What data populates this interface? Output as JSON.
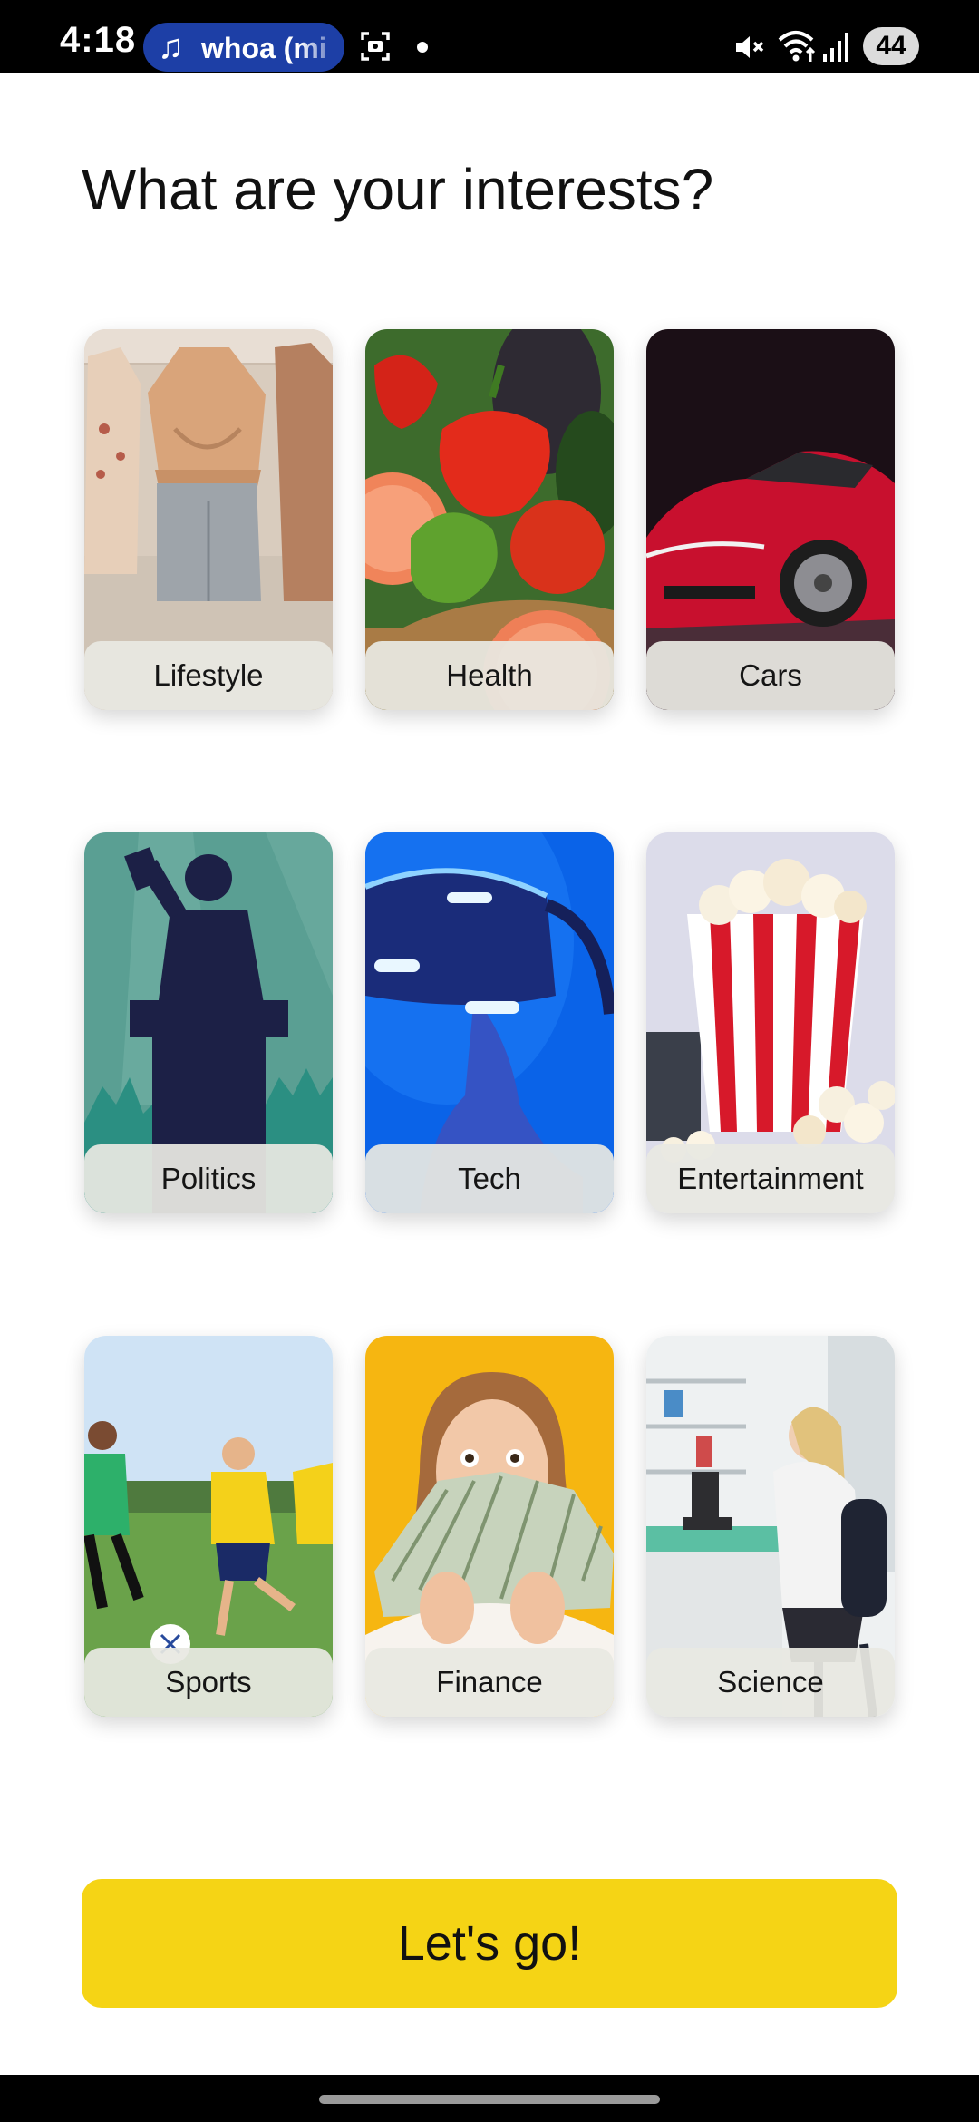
{
  "status_bar": {
    "time": "4:18",
    "media_text": "whoa (mi",
    "battery": "44",
    "icons": [
      "music-note-icon",
      "screenshot-icon",
      "notification-dot",
      "mute-icon",
      "wifi-icon",
      "signal-icon",
      "battery-icon"
    ]
  },
  "page": {
    "title": "What are your interests?"
  },
  "interests": [
    {
      "label": "Lifestyle",
      "image": "clothing-outfits"
    },
    {
      "label": "Health",
      "image": "vegetables-basket"
    },
    {
      "label": "Cars",
      "image": "red-sports-car"
    },
    {
      "label": "Politics",
      "image": "speaker-at-podium"
    },
    {
      "label": "Tech",
      "image": "vr-headset"
    },
    {
      "label": "Entertainment",
      "image": "popcorn-bucket"
    },
    {
      "label": "Sports",
      "image": "kids-playing-soccer"
    },
    {
      "label": "Finance",
      "image": "woman-holding-cash"
    },
    {
      "label": "Science",
      "image": "scientist-with-microscope"
    }
  ],
  "cta": {
    "label": "Let's go!"
  },
  "colors": {
    "cta_background": "#f5d415",
    "app_background": "#ffffff",
    "media_pill": "#1d3fa6",
    "label_bar": "#e8e8e2"
  }
}
